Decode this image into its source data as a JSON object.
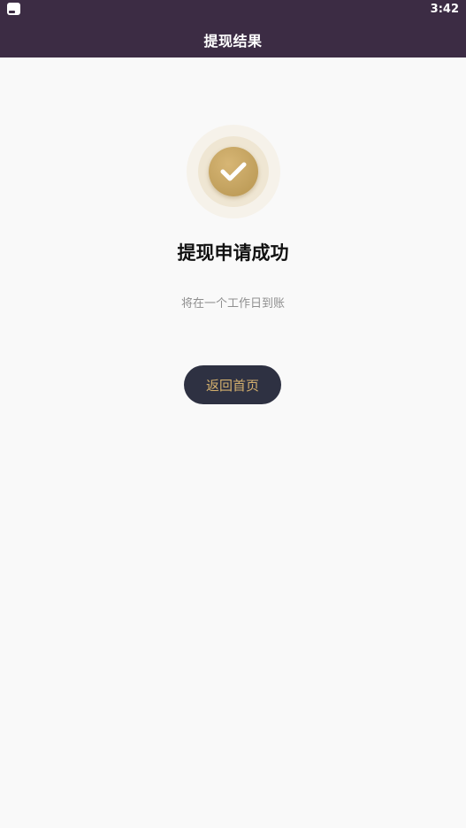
{
  "status_bar": {
    "time": "3:42",
    "app_icon": "app-notification-icon"
  },
  "header": {
    "title": "提现结果"
  },
  "result": {
    "icon": "check-icon",
    "title": "提现申请成功",
    "subtitle": "将在一个工作日到账"
  },
  "actions": {
    "home_button_label": "返回首页"
  },
  "colors": {
    "header_bg": "#3c2c44",
    "accent_gold": "#c3a25f",
    "button_bg": "#2e3142",
    "button_text": "#d4b06d",
    "page_bg": "#f9f9f9"
  }
}
